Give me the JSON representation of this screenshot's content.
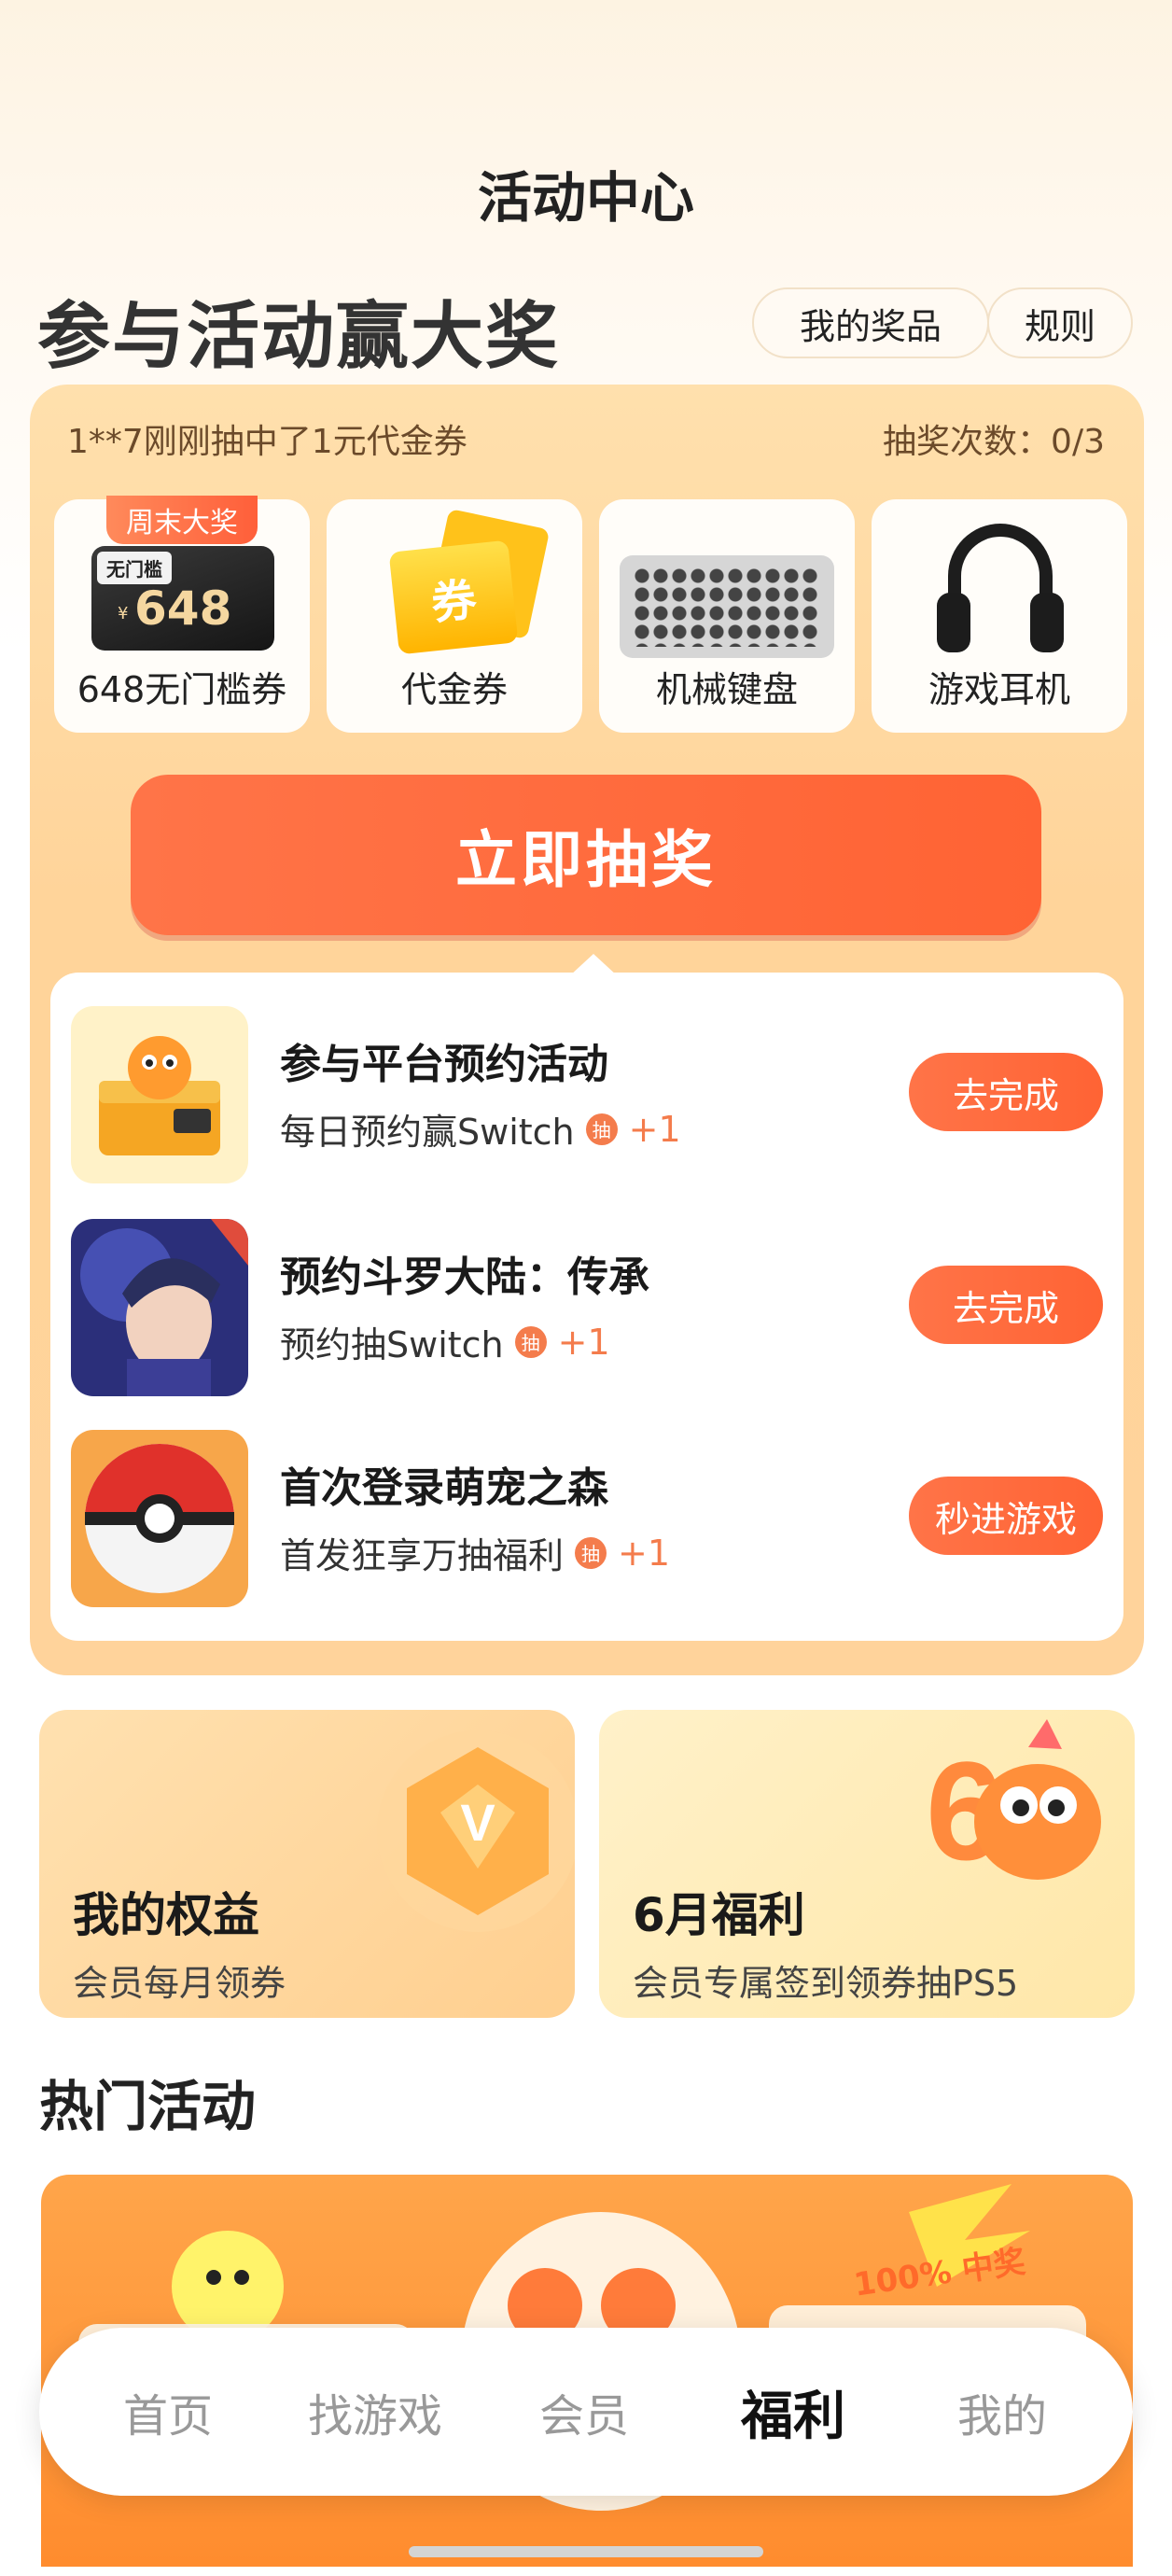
{
  "header": {
    "title": "活动中心"
  },
  "hero": {
    "title": "参与活动赢大奖",
    "my_prizes": "我的奖品",
    "rules": "规则"
  },
  "lottery": {
    "ticker": "1**7刚刚抽中了1元代金券",
    "draw_count": "抽奖次数：0/3",
    "prizes": [
      {
        "label": "648无门槛券",
        "badge": "周末大奖",
        "coupon_tag": "无门槛",
        "coupon_currency": "¥",
        "coupon_amount": "648"
      },
      {
        "label": "代金券",
        "voucher_text": "券"
      },
      {
        "label": "机械键盘"
      },
      {
        "label": "游戏耳机"
      }
    ],
    "draw_button": "立即抽奖"
  },
  "tasks": [
    {
      "title": "参与平台预约活动",
      "subtitle": "每日预约赢Switch",
      "chou": "抽",
      "plus": "+1",
      "button": "去完成"
    },
    {
      "title": "预约斗罗大陆：传承",
      "subtitle": "预约抽Switch",
      "chou": "抽",
      "plus": "+1",
      "button": "去完成"
    },
    {
      "title": "首次登录萌宠之森",
      "subtitle": "首发狂享万抽福利",
      "chou": "抽",
      "plus": "+1",
      "button": "秒进游戏"
    }
  ],
  "benefits": [
    {
      "title": "我的权益",
      "subtitle": "会员每月领券"
    },
    {
      "title": "6月福利",
      "subtitle": "会员专属签到领券抽PS5"
    }
  ],
  "hot": {
    "title": "热门活动",
    "banner_badge": "100% 中奖"
  },
  "tabbar": {
    "items": [
      "首页",
      "找游戏",
      "会员",
      "福利",
      "我的"
    ],
    "active_index": 3
  },
  "colors": {
    "accent": "#ff6a3d",
    "card_bg": "#ffd9a3",
    "text": "#222222"
  }
}
